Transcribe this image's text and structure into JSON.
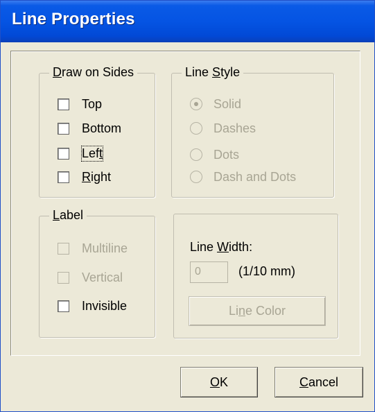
{
  "window": {
    "title": "Line Properties"
  },
  "draw_on_sides": {
    "label_pre": "D",
    "label_post": "raw on Sides",
    "top": {
      "label": "Top",
      "checked": false
    },
    "bottom": {
      "label": "Bottom",
      "checked": false
    },
    "left": {
      "label_pre": "Lef",
      "label_u": "t",
      "checked": false
    },
    "right": {
      "label_pre": "",
      "label_u": "R",
      "label_post": "ight",
      "checked": false
    }
  },
  "line_style": {
    "label_pre": "Line ",
    "label_u": "S",
    "label_post": "tyle",
    "options": [
      {
        "label": "Solid",
        "selected": true
      },
      {
        "label": "Dashes",
        "selected": false
      },
      {
        "label": "Dots",
        "selected": false
      },
      {
        "label": "Dash and Dots",
        "selected": false
      }
    ]
  },
  "label_group": {
    "label_u": "L",
    "label_post": "abel",
    "multiline": "Multiline",
    "vertical": "Vertical",
    "invisible": "Invisible"
  },
  "line_width": {
    "label_pre": "Line ",
    "label_u": "W",
    "label_post": "idth:",
    "value": "0",
    "unit": "(1/10 mm)",
    "color_btn_pre": "Li",
    "color_btn_u": "n",
    "color_btn_post": "e Color"
  },
  "buttons": {
    "ok_u": "O",
    "ok_post": "K",
    "cancel_u": "C",
    "cancel_post": "ancel"
  }
}
